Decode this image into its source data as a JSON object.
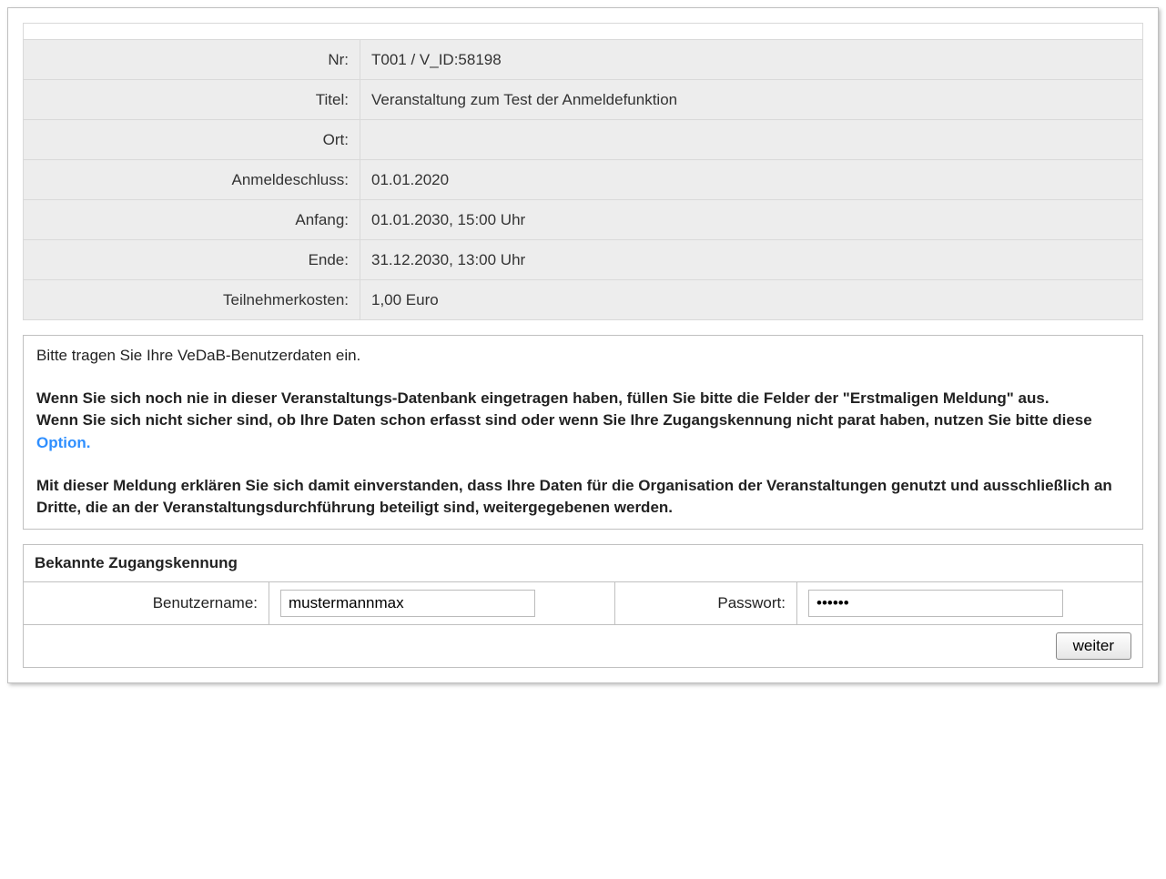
{
  "details": {
    "nr": {
      "label": "Nr:",
      "value": "T001 / V_ID:58198"
    },
    "titel": {
      "label": "Titel:",
      "value": "Veranstaltung zum Test der Anmeldefunktion"
    },
    "ort": {
      "label": "Ort:",
      "value": ""
    },
    "anmeldeschluss": {
      "label": "Anmeldeschluss:",
      "value": "01.01.2020"
    },
    "anfang": {
      "label": "Anfang:",
      "value": "01.01.2030,  15:00 Uhr"
    },
    "ende": {
      "label": "Ende:",
      "value": "31.12.2030,  13:00 Uhr"
    },
    "teilnehmerkosten": {
      "label": "Teilnehmerkosten:",
      "value": "1,00 Euro"
    }
  },
  "info": {
    "intro": "Bitte tragen Sie Ihre VeDaB-Benutzerdaten ein.",
    "para1": "Wenn Sie sich noch nie in dieser Veranstaltungs-Datenbank eingetragen haben, füllen Sie bitte die Felder der \"Erstmaligen Meldung\" aus.",
    "para2_pre": "Wenn Sie sich nicht sicher sind, ob Ihre Daten schon erfasst sind oder wenn Sie Ihre Zugangskennung nicht parat haben, nutzen Sie bitte diese ",
    "option_link": "Option.",
    "para3": "Mit dieser Meldung erklären Sie sich damit einverstanden, dass Ihre Daten für die Organisation der Veranstaltungen genutzt und ausschließlich an Dritte, die an der Veranstaltungsdurchführung beteiligt sind, weitergegebenen werden."
  },
  "login": {
    "section_title": "Bekannte Zugangskennung",
    "username_label": "Benutzername:",
    "username_value": "mustermannmax",
    "password_label": "Passwort:",
    "password_value": "••••••",
    "submit_label": "weiter"
  }
}
